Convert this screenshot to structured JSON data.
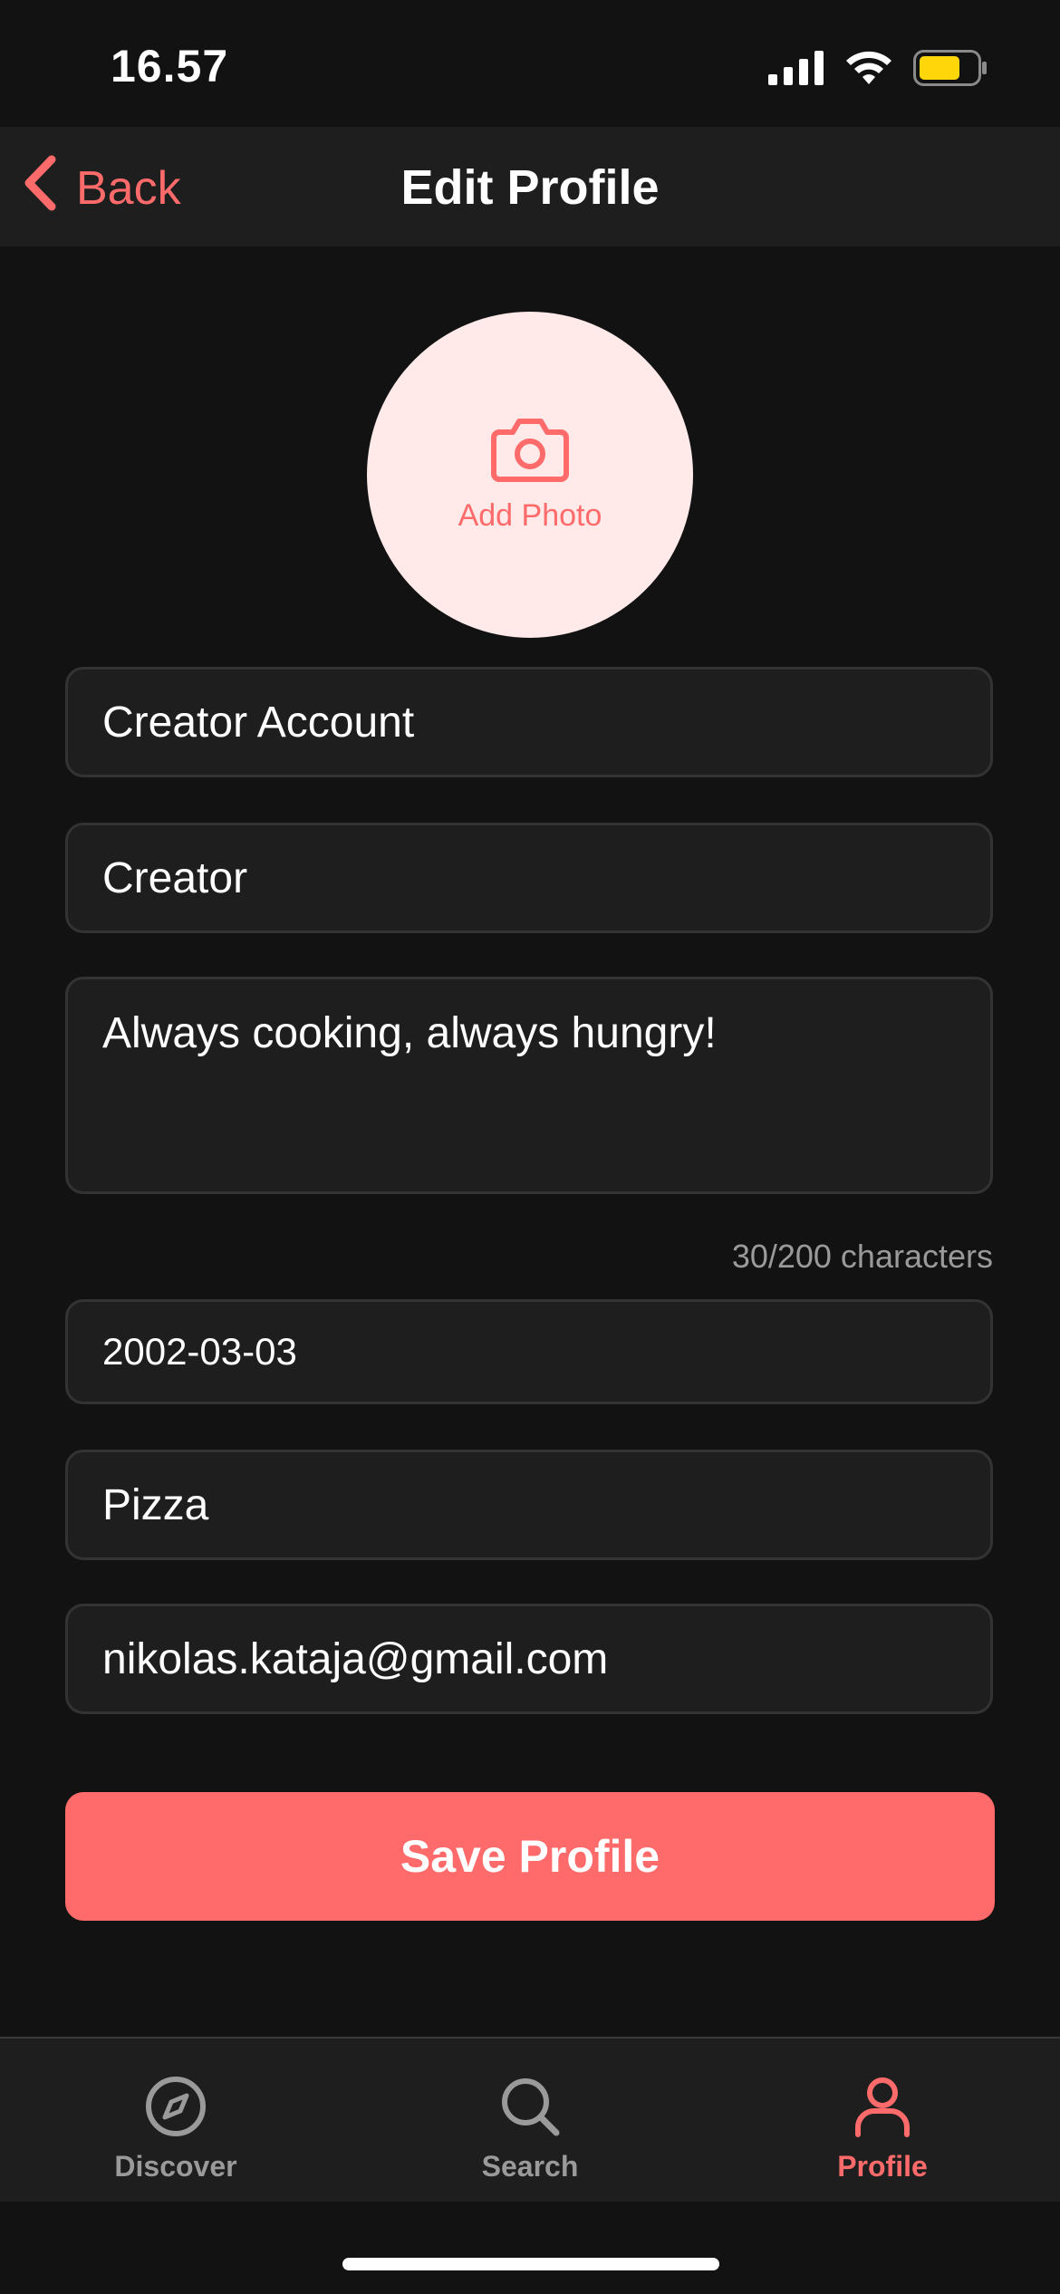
{
  "status_bar": {
    "time": "16.57",
    "battery_color": "#ffd60a",
    "icons": [
      "signal-icon",
      "wifi-icon",
      "battery-icon"
    ]
  },
  "nav": {
    "back_label": "Back",
    "title": "Edit Profile",
    "back_icon": "chevron-left-icon"
  },
  "photo": {
    "label": "Add Photo",
    "icon": "camera-icon"
  },
  "form": {
    "name_value": "Creator Account",
    "username_value": "Creator",
    "bio_value": "Always cooking, always hungry!",
    "bio_char_count": "30/200 characters",
    "birthdate_value": "2002-03-03",
    "favorite_food_value": "Pizza",
    "email_value": "nikolas.kataja@gmail.com",
    "save_label": "Save Profile"
  },
  "tabs": [
    {
      "label": "Discover",
      "icon": "compass-icon",
      "active": false
    },
    {
      "label": "Search",
      "icon": "search-icon",
      "active": false
    },
    {
      "label": "Profile",
      "icon": "user-icon",
      "active": true
    }
  ],
  "colors": {
    "accent": "#ff6b6b",
    "background": "#121212",
    "surface": "#1e1e1e",
    "photo_bg": "#ffe9e9",
    "inactive_tab": "#9a9a9a"
  }
}
